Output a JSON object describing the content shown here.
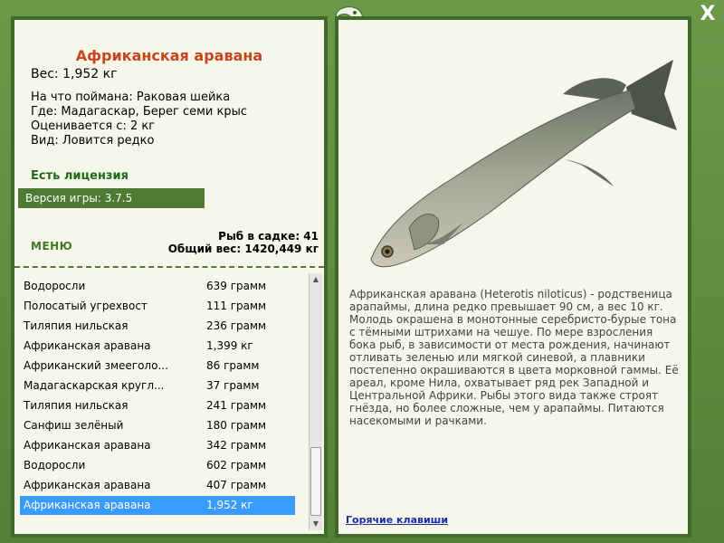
{
  "fish": {
    "title": "Африканская аравана",
    "weight": "Вес: 1,952 кг",
    "bait": "На что поймана: Раковая шейка",
    "place": "Где: Мадагаскар, Берег семи крыс",
    "valued": "Оценивается с: 2 кг",
    "kind": "Вид: Ловится редко",
    "description": "Африканская аравана (Heterotis niloticus) - родственица арапаймы, длина редко превышает 90 см, а вес 10 кг. Молодь окрашена в монотонные серебристо-бурые тона с тёмными штрихами на чешуе. По мере взросления бока рыб, в зависимости от места рождения, начинают отливать зеленью или мягкой синевой, а плавники постепенно окрашиваются в цвета морковной гаммы. Её ареал, кроме Нила, охватывает ряд рек Западной и Центральной Африки. Рыбы этого вида также строят гнёзда, но более сложные, чем у арапаймы. Питаются насекомыми и рачками."
  },
  "license": "Есть лицензия",
  "version": "Версия игры: 3.7.5",
  "menu_label": "МЕНЮ",
  "stats": {
    "count": "Рыб в садке: 41",
    "total": "Общий вес: 1420,449 кг"
  },
  "catch_list": [
    {
      "name": "Водоросли",
      "weight": "639 грамм"
    },
    {
      "name": "Полосатый угрехвост",
      "weight": "111 грамм"
    },
    {
      "name": "Тиляпия нильская",
      "weight": "236 грамм"
    },
    {
      "name": "Африканская аравана",
      "weight": "1,399 кг"
    },
    {
      "name": "Африканский змееголо...",
      "weight": "86 грамм"
    },
    {
      "name": "Мадагаскарская кругл...",
      "weight": "37 грамм"
    },
    {
      "name": "Тиляпия нильская",
      "weight": "241 грамм"
    },
    {
      "name": "Санфиш зелёный",
      "weight": "180 грамм"
    },
    {
      "name": "Африканская аравана",
      "weight": "342 грамм"
    },
    {
      "name": "Водоросли",
      "weight": "602 грамм"
    },
    {
      "name": "Африканская аравана",
      "weight": "407 грамм"
    },
    {
      "name": "Африканская аравана",
      "weight": "1,952 кг",
      "selected": true
    }
  ],
  "hotkeys": "Горячие клавиши",
  "close_glyph": "X"
}
